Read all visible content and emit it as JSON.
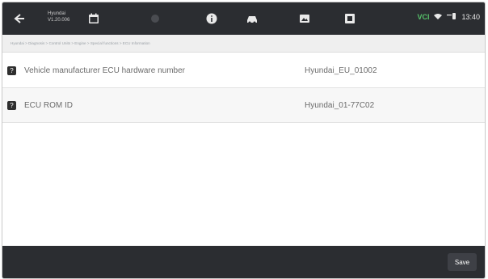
{
  "topbar": {
    "device_line1": "Hyundai",
    "device_line2": "V1.20.006",
    "status": {
      "vci": "VCI",
      "time": "13:40"
    },
    "icons": [
      "back-icon",
      "calendar-icon",
      "disabled-icon",
      "info-icon",
      "car-icon",
      "screenshot-icon",
      "document-icon",
      "wifi-icon",
      "battery-icon"
    ]
  },
  "breadcrumb": "Hyundai > Diagnosis > Control Units > Engine > Special functions > ECU Information",
  "rows": [
    {
      "label": "Vehicle manufacturer ECU hardware number",
      "value": "Hyundai_EU_01002"
    },
    {
      "label": "ECU ROM ID",
      "value": "Hyundai_01-77C02"
    }
  ],
  "footer": {
    "save_label": "Save"
  },
  "colors": {
    "bar": "#2b2d31",
    "vci": "#56c16a"
  }
}
